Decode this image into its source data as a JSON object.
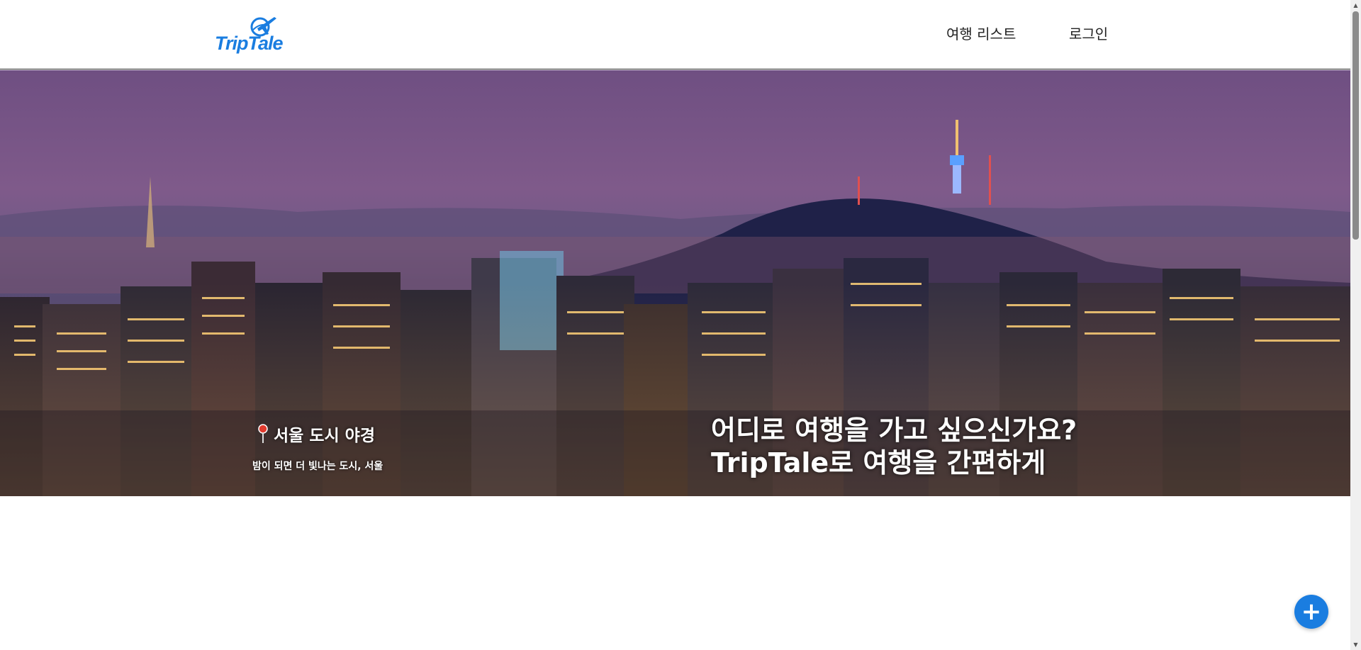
{
  "header": {
    "logo_text": "TripTale",
    "nav": {
      "trip_list": "여행 리스트",
      "login": "로그인"
    }
  },
  "hero": {
    "place_title": "서울 도시 야경",
    "place_subtitle": "밤이 되면 더 빛나는 도시, 서울",
    "headline_line1": "어디로 여행을 가고 싶으신가요?",
    "headline_line2": "TripTale로 여행을 간편하게"
  },
  "fab": {
    "label": "+"
  },
  "icons": {
    "logo": "airplane-globe-icon",
    "pin": "map-pin-icon",
    "fab": "plus-icon"
  },
  "colors": {
    "brand": "#1a7de0",
    "header_text": "#222222"
  }
}
